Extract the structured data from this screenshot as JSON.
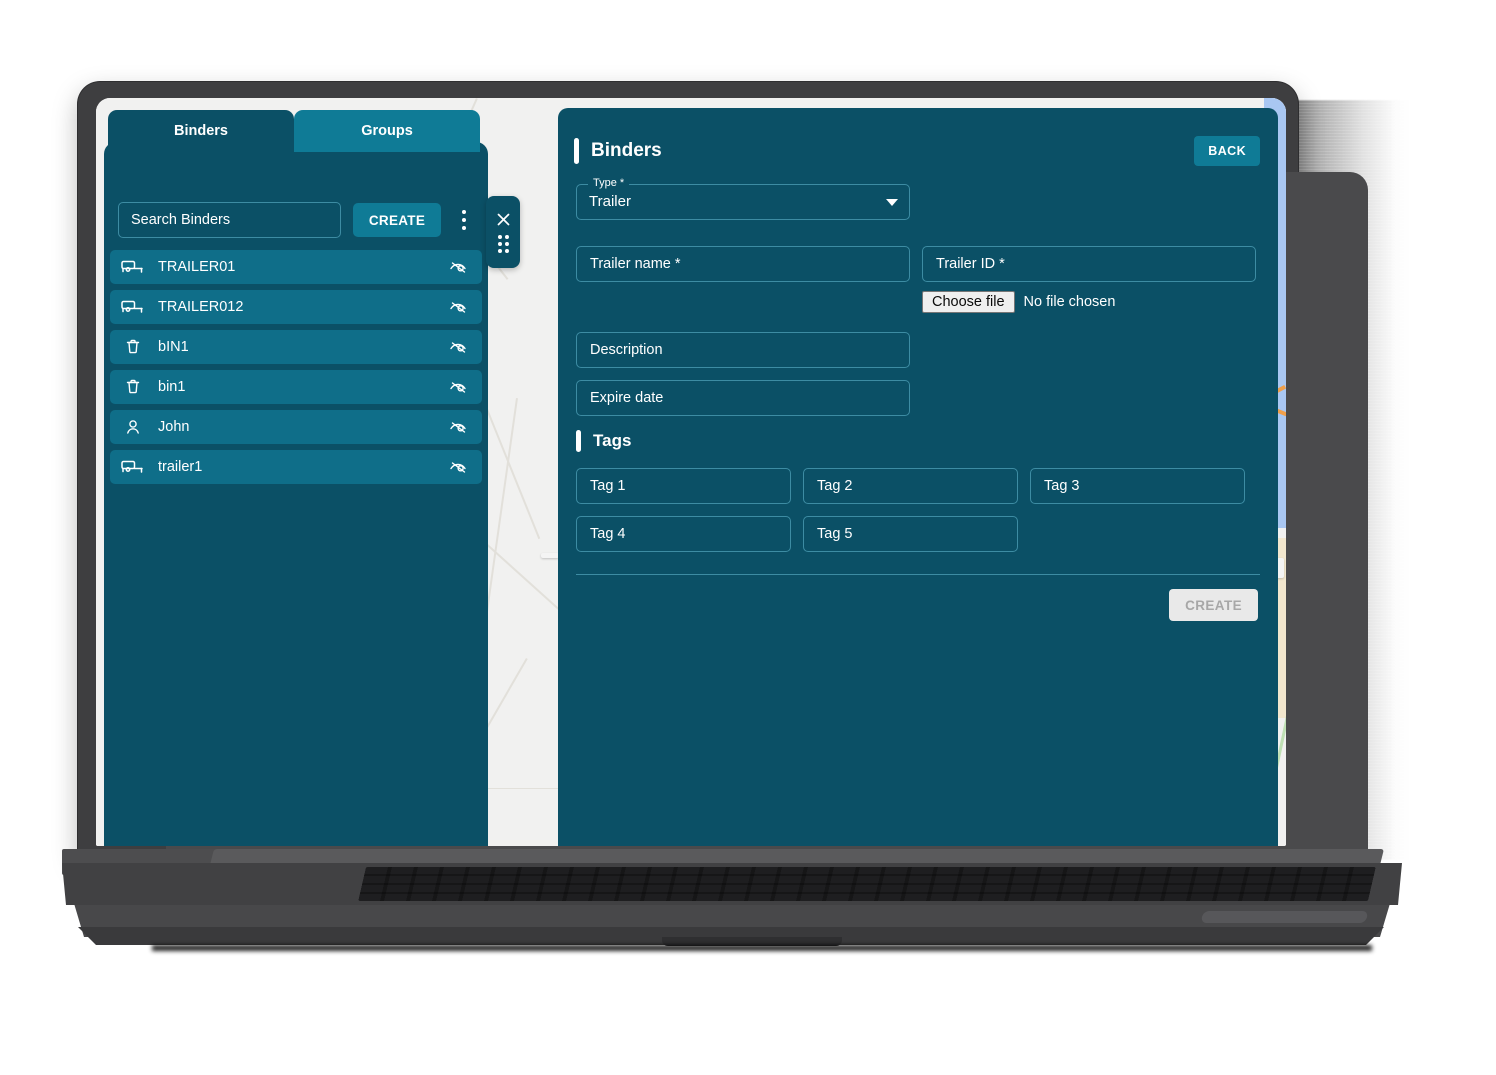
{
  "left_panel": {
    "tabs": [
      {
        "label": "Binders",
        "active": true
      },
      {
        "label": "Groups",
        "active": false
      }
    ],
    "search": {
      "placeholder": "Search Binders",
      "value": ""
    },
    "create_label": "CREATE",
    "menu_icon": "kebab-menu-icon",
    "items": [
      {
        "label": "TRAILER01",
        "icon": "trailer-icon",
        "visibility_icon": "eye-off-icon"
      },
      {
        "label": "TRAILER012",
        "icon": "trailer-icon",
        "visibility_icon": "eye-off-icon"
      },
      {
        "label": "bIN1",
        "icon": "trash-bin-icon",
        "visibility_icon": "eye-off-icon"
      },
      {
        "label": "bin1",
        "icon": "trash-bin-icon",
        "visibility_icon": "eye-off-icon"
      },
      {
        "label": "John",
        "icon": "person-icon",
        "visibility_icon": "eye-off-icon"
      },
      {
        "label": "trailer1",
        "icon": "trailer-icon",
        "visibility_icon": "eye-off-icon"
      }
    ]
  },
  "float_handle": {
    "close_icon": "close-x-icon",
    "drag_icon": "drag-dots-icon"
  },
  "right_panel": {
    "title": "Binders",
    "back_label": "BACK",
    "type_field": {
      "label": "Type *",
      "value": "Trailer",
      "caret_icon": "chevron-down-icon"
    },
    "fields": [
      {
        "placeholder": "Trailer name *",
        "value": ""
      },
      {
        "placeholder": "Trailer ID *",
        "value": ""
      },
      {
        "placeholder": "Description",
        "value": ""
      },
      {
        "placeholder": "Expire date",
        "value": ""
      }
    ],
    "file_input": {
      "button_label": "Choose file",
      "status": "No file chosen"
    },
    "tags_title": "Tags",
    "tags": [
      {
        "placeholder": "Tag 1",
        "value": ""
      },
      {
        "placeholder": "Tag 2",
        "value": ""
      },
      {
        "placeholder": "Tag 3",
        "value": ""
      },
      {
        "placeholder": "Tag 4",
        "value": ""
      },
      {
        "placeholder": "Tag 5",
        "value": ""
      }
    ],
    "create_label": "CREATE"
  },
  "colors": {
    "panel_bg": "#0b5066",
    "accent": "#0f7b96",
    "list_item": "#0f6e89",
    "field_border": "#3d8ca3",
    "text": "#ffffff",
    "disabled_button_bg": "#e9e9e9",
    "disabled_button_text": "#a7a7a7"
  }
}
